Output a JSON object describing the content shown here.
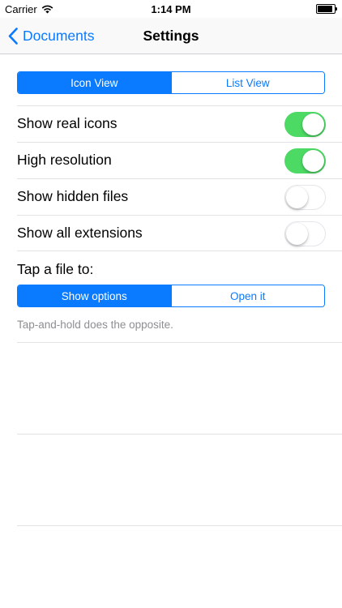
{
  "status_bar": {
    "carrier": "Carrier",
    "time": "1:14 PM",
    "battery_level": 1.0
  },
  "nav": {
    "back_label": "Documents",
    "title": "Settings"
  },
  "view_mode": {
    "options": [
      "Icon View",
      "List View"
    ],
    "selected": "Icon View"
  },
  "toggles": [
    {
      "label": "Show real icons",
      "on": true
    },
    {
      "label": "High resolution",
      "on": true
    },
    {
      "label": "Show hidden files",
      "on": false
    },
    {
      "label": "Show all extensions",
      "on": false
    }
  ],
  "tap_action": {
    "label": "Tap a file to:",
    "options": [
      "Show options",
      "Open it"
    ],
    "selected": "Show options",
    "footnote": "Tap-and-hold does the opposite."
  },
  "colors": {
    "accent": "#0a7aff",
    "toggle_on": "#4cd964"
  }
}
